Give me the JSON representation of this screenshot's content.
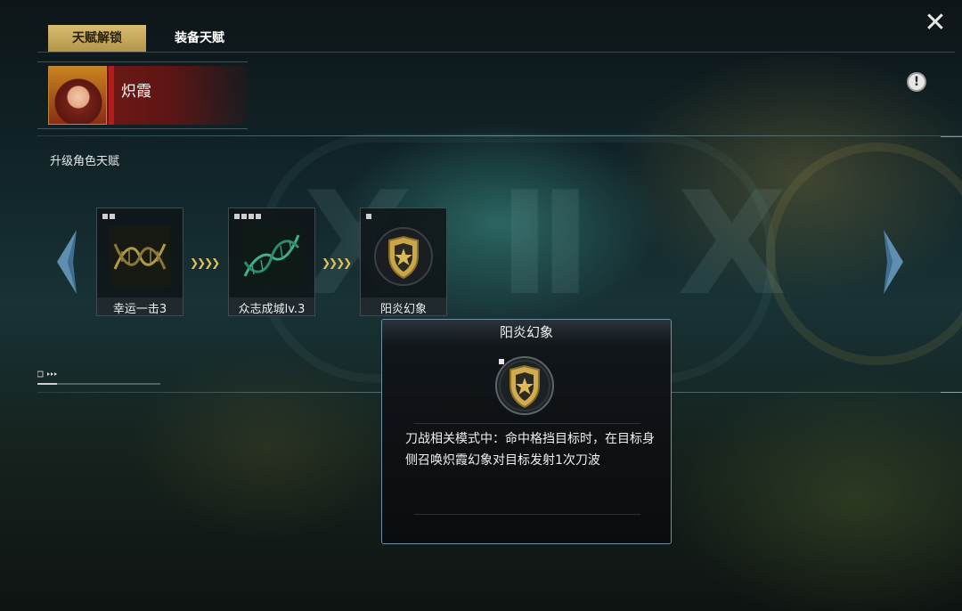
{
  "tabs": [
    {
      "label": "天赋解锁",
      "active": true
    },
    {
      "label": "装备天赋",
      "active": false
    }
  ],
  "character": {
    "name": "炽霞"
  },
  "section_label": "升级角色天赋",
  "talent_chain": [
    {
      "label": "幸运一击3",
      "pips": 2,
      "icon": "dna-helix-gold-icon"
    },
    {
      "label": "众志成城lv.3",
      "pips": 4,
      "icon": "dna-helix-green-icon"
    },
    {
      "label": "阳炎幻象",
      "pips": 1,
      "icon": "shield-star-icon"
    }
  ],
  "tooltip": {
    "title": "阳炎幻象",
    "icon": "shield-star-icon",
    "description": "刀战相关模式中：命中格挡目标时，在目标身侧召唤炽霞幻象对目标发射1次刀波"
  },
  "colors": {
    "accent_gold": "#d9bd70",
    "character_red": "#7a1a18",
    "tooltip_border": "#6f8fa6",
    "chevron_gold": "#e2c25a"
  }
}
